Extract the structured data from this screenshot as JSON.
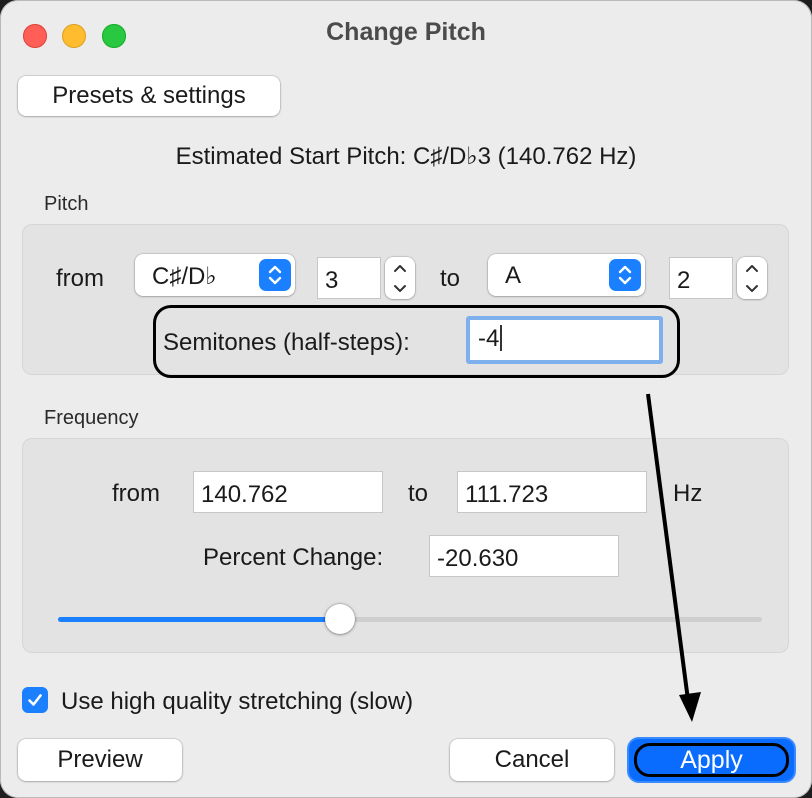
{
  "window": {
    "title": "Change Pitch"
  },
  "buttons": {
    "presets": "Presets & settings",
    "preview": "Preview",
    "cancel": "Cancel",
    "apply": "Apply"
  },
  "estimated_start_pitch": "Estimated Start Pitch: C♯/D♭3 (140.762 Hz)",
  "pitch": {
    "section_label": "Pitch",
    "from_label": "from",
    "from_note": "C♯/D♭",
    "from_octave": "3",
    "to_label": "to",
    "to_note": "A",
    "to_octave": "2",
    "semitones_label": "Semitones (half-steps):",
    "semitones_value": "-4"
  },
  "frequency": {
    "section_label": "Frequency",
    "from_label": "from",
    "from_value": "140.762",
    "to_label": "to",
    "to_value": "111.723",
    "unit": "Hz",
    "percent_label": "Percent Change:",
    "percent_value": "-20.630",
    "slider_fraction": 0.4
  },
  "options": {
    "high_quality_label": "Use high quality stretching (slow)",
    "high_quality_checked": true
  },
  "colors": {
    "accent": "#1a80ff",
    "apply_button": "#0a6cff",
    "window_bg": "#ececec"
  },
  "icons": [
    "close-window-icon",
    "minimize-window-icon",
    "zoom-window-icon",
    "chevron-up-down-icon",
    "checkmark-icon",
    "annotation-arrow-icon"
  ]
}
